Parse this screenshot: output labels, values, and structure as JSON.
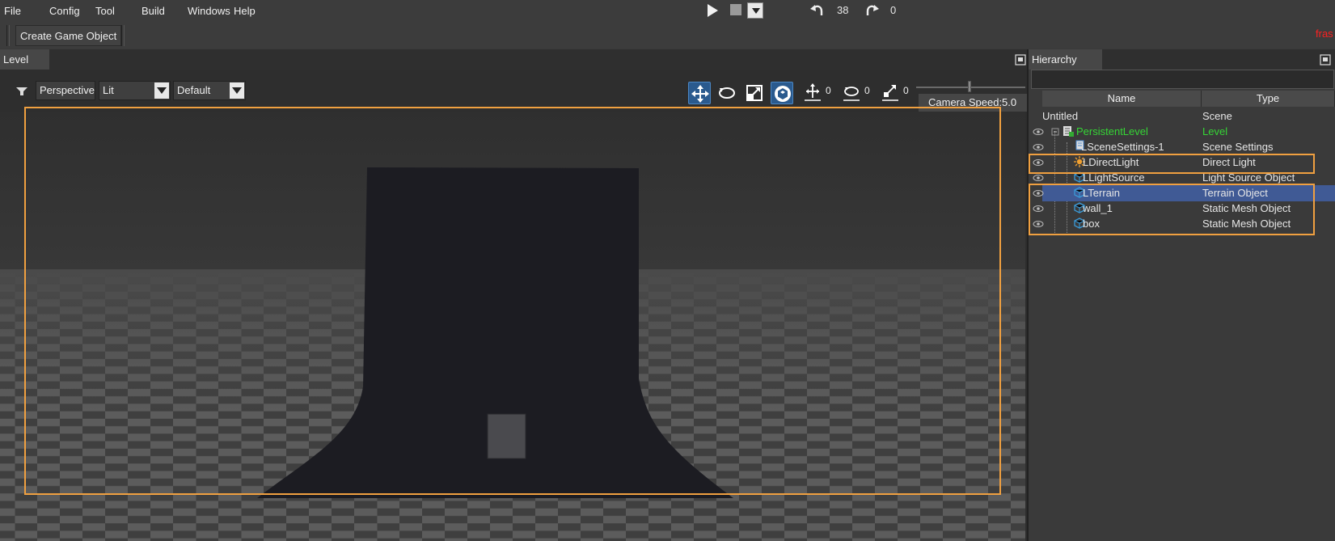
{
  "menu": {
    "items": [
      "File",
      "Config",
      "Tool",
      "Build",
      "Windows",
      "Help"
    ]
  },
  "playbar": {
    "undo_count": "38",
    "redo_count": "0"
  },
  "toolbar": {
    "create_label": "Create Game Object",
    "red_label": "fras"
  },
  "level": {
    "tab_label": "Level",
    "view_label": "Perspective",
    "shading": "Lit",
    "preset": "Default",
    "translate_value": "0",
    "rotate_value": "0",
    "scale_value": "0",
    "camera_speed": "Camera Speed:5.0"
  },
  "hierarchy": {
    "tab_label": "Hierarchy",
    "col_name": "Name",
    "col_type": "Type",
    "rows": [
      {
        "name": "Untitled",
        "type": "Scene"
      },
      {
        "name": "PersistentLevel",
        "type": "Level"
      },
      {
        "name": "LSceneSettings-1",
        "type": "Scene Settings"
      },
      {
        "name": "LDirectLight",
        "type": "Direct Light"
      },
      {
        "name": "LLightSource",
        "type": "Light Source Object"
      },
      {
        "name": "LTerrain",
        "type": "Terrain Object"
      },
      {
        "name": "wall_1",
        "type": "Static Mesh Object"
      },
      {
        "name": "box",
        "type": "Static Mesh Object"
      }
    ]
  },
  "colors": {
    "highlight": "#f0a040",
    "selection": "#405a95",
    "level_green": "#35d635"
  },
  "icons": {
    "play": "play-icon",
    "stop": "stop-icon",
    "undo": "undo-icon",
    "redo": "redo-icon",
    "translate": "translate-icon",
    "rotate": "rotate-icon",
    "scale": "scale-icon",
    "local": "local-space-icon",
    "eye": "eye-icon",
    "light": "sun-icon",
    "mesh": "cube-icon",
    "settings": "settings-doc-icon"
  }
}
